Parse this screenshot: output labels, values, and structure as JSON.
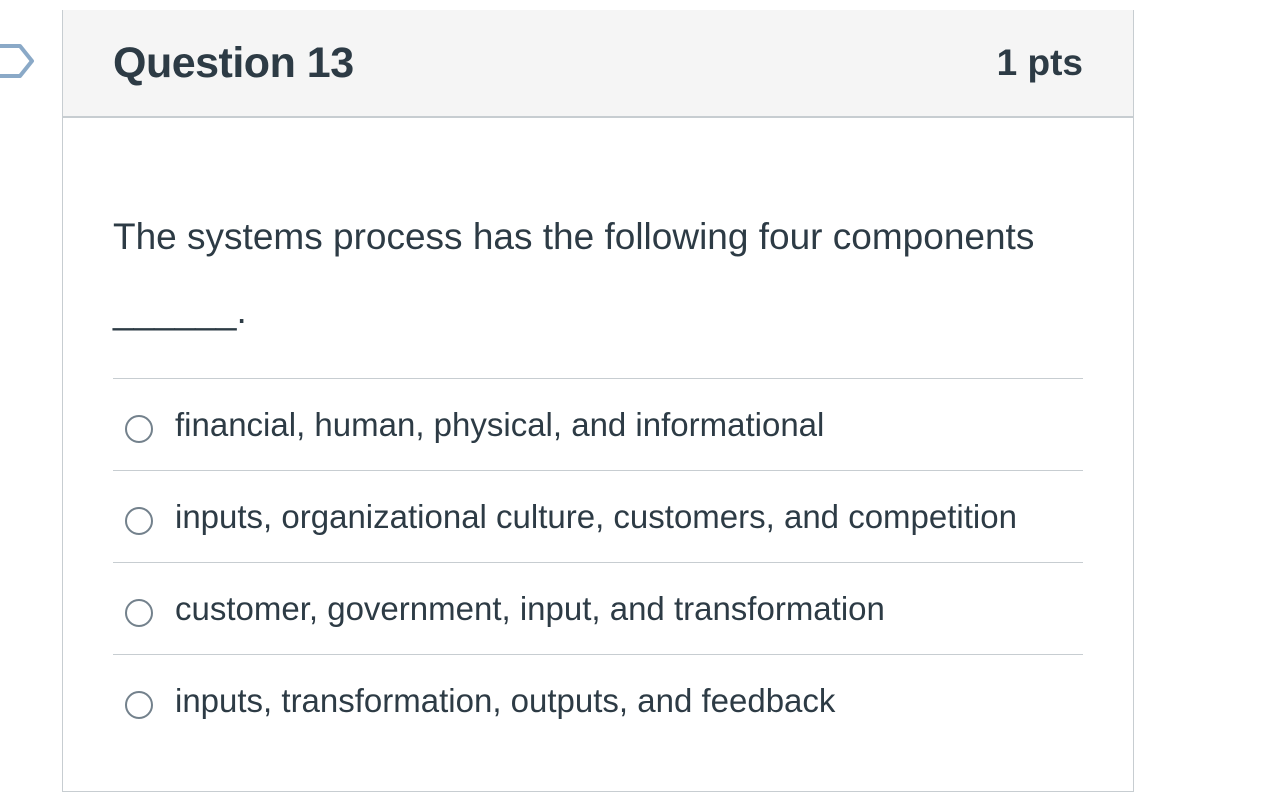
{
  "question": {
    "title": "Question 13",
    "points": "1 pts",
    "text_line1": "The systems process has the following four components",
    "text_line2": "______."
  },
  "answers": [
    {
      "label": "financial, human, physical, and informational",
      "selected": false
    },
    {
      "label": "inputs, organizational culture, customers, and competition",
      "selected": false
    },
    {
      "label": "customer, government, input, and transformation",
      "selected": false
    },
    {
      "label": "inputs, transformation, outputs, and feedback",
      "selected": false
    }
  ],
  "colors": {
    "text": "#2d3b45",
    "header_bg": "#f5f5f5",
    "border": "#c7cdd1",
    "radio_border": "#73818c"
  },
  "icons": {
    "flag": "bookmark-flag-icon"
  }
}
